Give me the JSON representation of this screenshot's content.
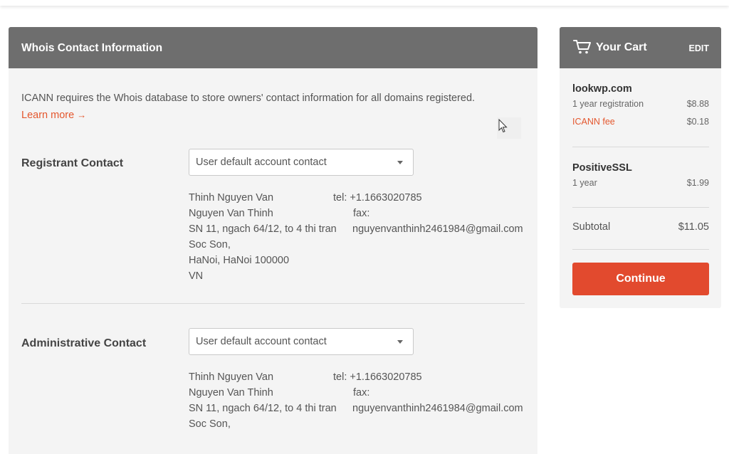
{
  "whois": {
    "title": "Whois Contact Information",
    "intro_text": "ICANN requires the Whois database to store owners' contact information for all domains registered.",
    "learn_more": "Learn more",
    "learn_more_arrow": "→"
  },
  "contacts": [
    {
      "label": "Registrant Contact",
      "select_value": "User default account contact",
      "name": "Thinh Nguyen Van",
      "org": "Nguyen Van Thinh",
      "address": "SN 11, ngach 64/12, to 4 thi tran",
      "district": "Soc Son,",
      "city": "HaNoi, HaNoi 100000",
      "country": "VN",
      "tel": "tel: +1.1663020785",
      "fax": "fax:",
      "email": "nguyenvanthinh2461984@gmail.com"
    },
    {
      "label": "Administrative Contact",
      "select_value": "User default account contact",
      "name": "Thinh Nguyen Van",
      "org": "Nguyen Van Thinh",
      "address": "SN 11, ngach 64/12, to 4 thi tran",
      "district": "Soc Son,",
      "tel": "tel: +1.1663020785",
      "fax": "fax:",
      "email": "nguyenvanthinh2461984@gmail.com"
    }
  ],
  "cart": {
    "title": "Your Cart",
    "edit_label": "EDIT",
    "items": [
      {
        "name": "lookwp.com",
        "lines": [
          {
            "label": "1 year registration",
            "price": "$8.88"
          },
          {
            "label": "ICANN fee",
            "price": "$0.18"
          }
        ]
      },
      {
        "name": "PositiveSSL",
        "lines": [
          {
            "label": "1 year",
            "price": "$1.99"
          }
        ]
      }
    ],
    "subtotal_label": "Subtotal",
    "subtotal_value": "$11.05",
    "continue_label": "Continue"
  },
  "colors": {
    "header_bg": "#6e6e6e",
    "panel_bg": "#f4f4f4",
    "accent": "#e4572e",
    "continue_bg": "#e24a2e"
  },
  "icons": {
    "cart": "shopping-cart-icon",
    "caret": "chevron-down-icon",
    "cursor": "mouse-pointer-icon"
  }
}
